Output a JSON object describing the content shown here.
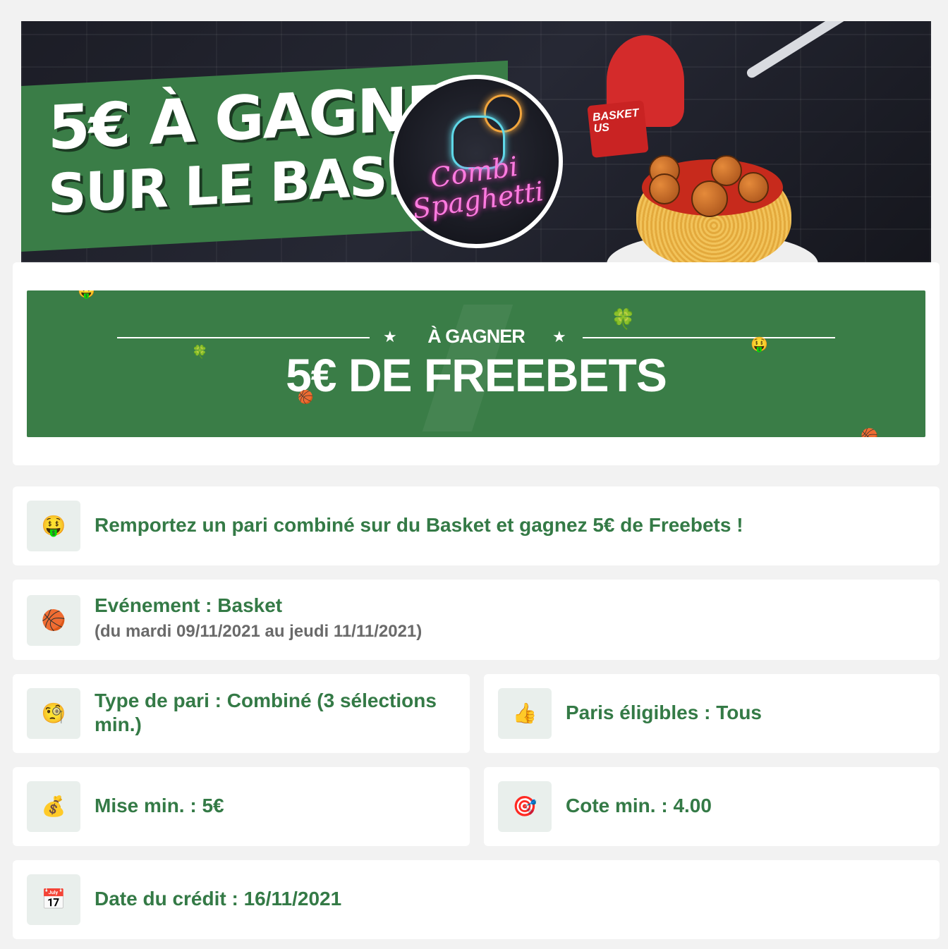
{
  "hero": {
    "title_line1": "5€ À GAGNER",
    "title_line2": "SUR LE BASKET",
    "logo_text_line1": "Combi",
    "logo_text_line2": "Spaghetti",
    "box_label_line1": "BASKET",
    "box_label_line2": "US"
  },
  "freebets": {
    "subtitle": "À GAGNER",
    "amount": "5€ DE FREEBETS",
    "star": "★"
  },
  "info": {
    "intro": {
      "icon": "money-mouth-face-icon",
      "glyph": "🤑",
      "text": "Remportez un pari combiné sur du Basket et gagnez 5€ de Freebets !"
    },
    "event": {
      "icon": "basketball-icon",
      "glyph": "🏀",
      "text": "Evénement : Basket",
      "sub": "(du mardi 09/11/2021 au jeudi 11/11/2021)"
    },
    "bet_type": {
      "icon": "face-with-monocle-icon",
      "glyph": "🧐",
      "text_line1": "Type de pari : Combiné (3 sélections",
      "text_line2": "min.)"
    },
    "eligible": {
      "icon": "thumbs-up-icon",
      "glyph": "👍",
      "text": "Paris éligibles : Tous"
    },
    "min_stake": {
      "icon": "money-bag-icon",
      "glyph": "💰",
      "text": "Mise min. : 5€"
    },
    "min_odds": {
      "icon": "direct-hit-icon",
      "glyph": "🎯",
      "text": "Cote min. : 4.00"
    },
    "credit_date": {
      "icon": "calendar-icon",
      "glyph": "📅",
      "text": "Date du crédit : 16/11/2021"
    }
  },
  "colors": {
    "brand_green": "#3a7d47",
    "text_green": "#347a46",
    "icon_bg": "#e9efec",
    "page_bg": "#f2f2f2"
  }
}
